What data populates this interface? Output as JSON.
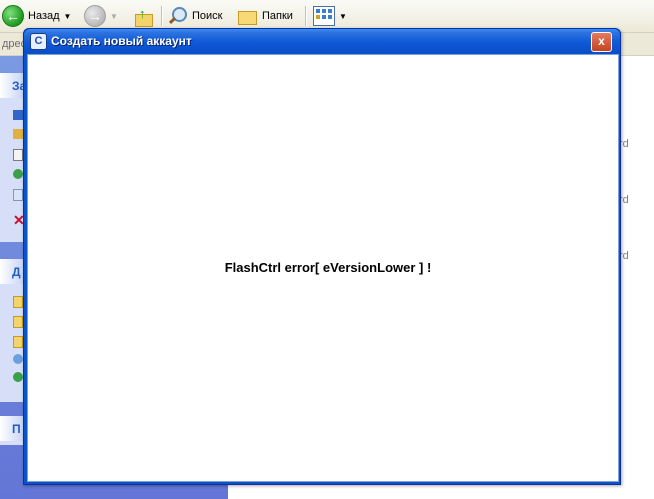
{
  "toolbar": {
    "back_label": "Назад",
    "search_label": "Поиск",
    "folders_label": "Папки"
  },
  "address": {
    "label_fragment": "дрес"
  },
  "left_pane": {
    "panel1_fragment": "За",
    "panel2_fragment": "Д",
    "panel3_fragment": "П"
  },
  "background_fragments": [
    "rd",
    "rd",
    "rd"
  ],
  "dialog": {
    "title": "Создать новый аккаунт",
    "close_symbol": "x",
    "error_text": "FlashCtrl error[ eVersionLower ] !"
  },
  "colors": {
    "titlebar": "#0b4ec8",
    "taskpane": "#6b85da",
    "close": "#d35a38"
  }
}
